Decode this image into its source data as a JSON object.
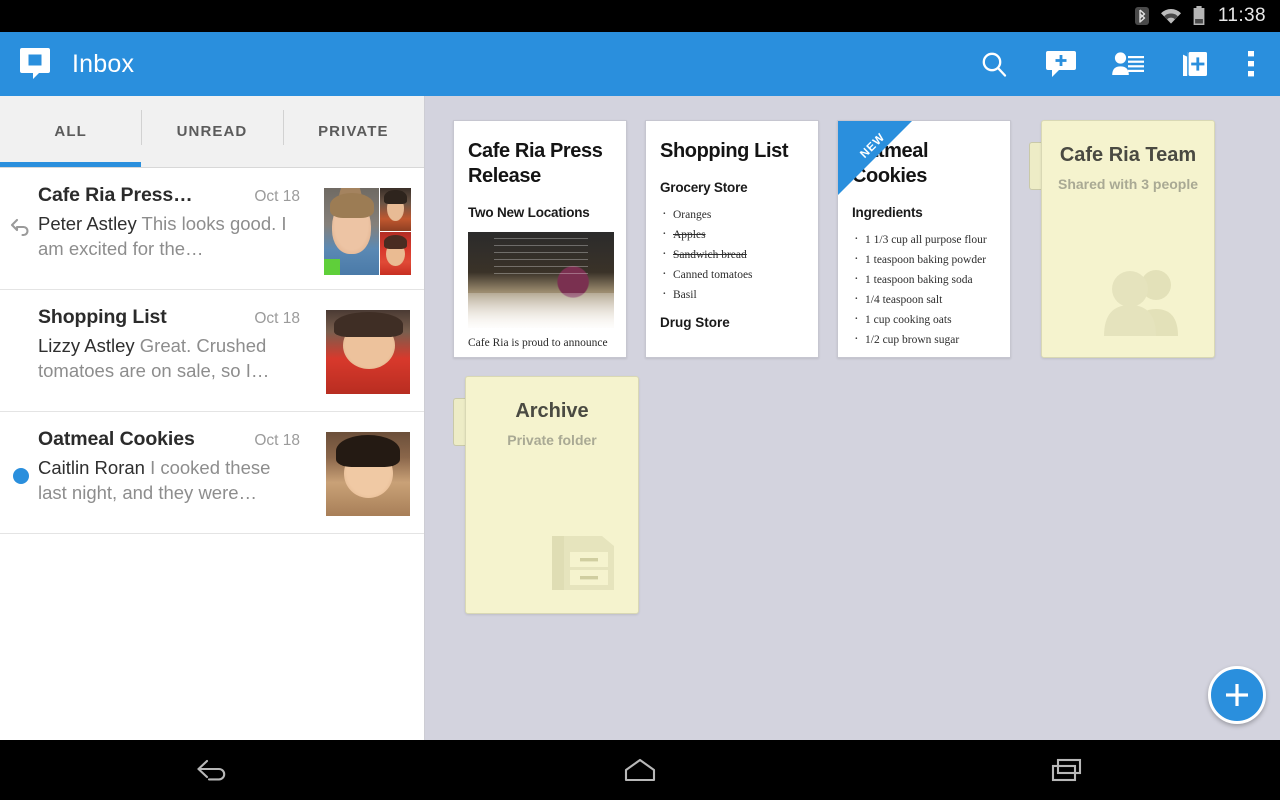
{
  "statusbar": {
    "time": "11:38",
    "icons": [
      "bluetooth-icon",
      "wifi-icon",
      "battery-icon"
    ]
  },
  "actionbar": {
    "logo": "quip-logo-icon",
    "title": "Inbox",
    "actions": [
      {
        "name": "search-icon",
        "label": "Search"
      },
      {
        "name": "new-message-icon",
        "label": "New message"
      },
      {
        "name": "contacts-icon",
        "label": "Contacts"
      },
      {
        "name": "new-document-icon",
        "label": "New document"
      },
      {
        "name": "overflow-menu-icon",
        "label": "More options"
      }
    ]
  },
  "tabs": [
    {
      "label": "ALL",
      "selected": true
    },
    {
      "label": "UNREAD",
      "selected": false
    },
    {
      "label": "PRIVATE",
      "selected": false
    }
  ],
  "threads": [
    {
      "title": "Cafe Ria Press…",
      "date": "Oct 18",
      "sender": "Peter Astley",
      "snippet": "This looks good. I am excited for the…",
      "marker": "reply-arrow-icon",
      "unread": false
    },
    {
      "title": "Shopping List",
      "date": "Oct 18",
      "sender": "Lizzy Astley",
      "snippet": "Great. Crushed tomatoes are on sale, so I…",
      "marker": "none",
      "unread": false
    },
    {
      "title": "Oatmeal Cookies",
      "date": "Oct 18",
      "sender": "Caitlin Roran",
      "snippet": "I cooked these last night, and they were…",
      "marker": "unread-dot",
      "unread": true
    }
  ],
  "notes": {
    "press_release": {
      "title": "Cafe Ria Press Release",
      "subtitle": "Two New Locations",
      "image": "cafe-photo",
      "body": "Cafe Ria is proud to announce"
    },
    "shopping_list": {
      "title": "Shopping List",
      "subtitle": "Grocery Store",
      "items": [
        {
          "text": "Oranges",
          "done": false
        },
        {
          "text": "Apples",
          "done": true
        },
        {
          "text": "Sandwich bread",
          "done": true
        },
        {
          "text": "Canned tomatoes",
          "done": false
        },
        {
          "text": "Basil",
          "done": false
        }
      ],
      "subtitle2": "Drug Store"
    },
    "oatmeal_cookies": {
      "title": "Oatmeal Cookies",
      "badge": "NEW",
      "subtitle": "Ingredients",
      "items": [
        "1 1/3 cup all purpose flour",
        "1 teaspoon baking powder",
        "1 teaspoon baking soda",
        "1/4 teaspoon salt",
        "1 cup cooking oats",
        "1/2 cup brown sugar"
      ]
    }
  },
  "folders": [
    {
      "title": "Cafe Ria Team",
      "subtitle": "Shared with 3 people",
      "glyph": "two-people-icon"
    },
    {
      "title": "Archive",
      "subtitle": "Private folder",
      "glyph": "file-cabinet-icon"
    }
  ],
  "fab": {
    "name": "compose-fab",
    "label": "+"
  },
  "navbar": [
    {
      "name": "nav-back-icon",
      "label": "Back"
    },
    {
      "name": "nav-home-icon",
      "label": "Home"
    },
    {
      "name": "nav-recents-icon",
      "label": "Recent apps"
    }
  ],
  "colors": {
    "accent": "#2a8fdd",
    "content_bg": "#d3d3de",
    "folder_bg": "#f5f3ce",
    "unread_dot": "#2a8fdd"
  }
}
